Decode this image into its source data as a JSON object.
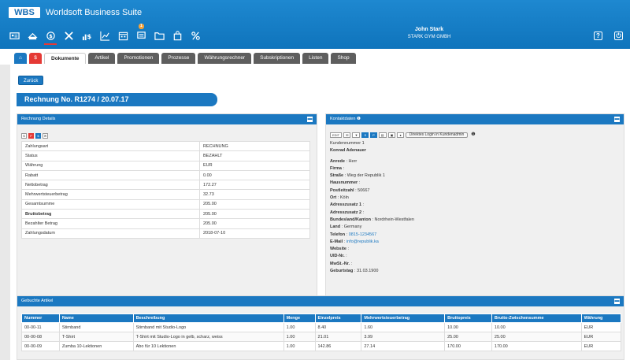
{
  "app": {
    "logo": "WBS",
    "title": "Worldsoft Business Suite"
  },
  "user": {
    "name": "John Stark",
    "company": "STARK GYM GMBH"
  },
  "header": {
    "help_label": "?",
    "power_label": "⏻",
    "notification_count": "1"
  },
  "tabs": [
    "Dokumente",
    "Artikel",
    "Promotionen",
    "Prozesse",
    "Währungsrechner",
    "Subskriptionen",
    "Listen",
    "Shop"
  ],
  "back_label": "Zurück",
  "heading": "Rechnung No. R1274 / 20.07.17",
  "details": {
    "title": "Rechnung Details",
    "rows": [
      {
        "label": "Zahlungsart",
        "value": "RECHNUNG"
      },
      {
        "label": "Status",
        "value": "BEZAHLT"
      },
      {
        "label": "Währung",
        "value": "EUR"
      },
      {
        "label": "Rabatt",
        "value": "0.00"
      },
      {
        "label": "Nettobetrag",
        "value": "172.27"
      },
      {
        "label": "Mehrwertsteuerbetrag",
        "value": "32.73"
      },
      {
        "label": "Gesamtsumme",
        "value": "205.00"
      },
      {
        "label": "Bruttobetrag",
        "value": "205.00"
      },
      {
        "label": "Bezahlter Betrag",
        "value": "205.00"
      },
      {
        "label": "Zahlungsdatum",
        "value": "2018-07-10"
      }
    ]
  },
  "contact": {
    "title": "Kontaktdaten",
    "edit_label": "EDIT",
    "direct_login_label": "Direktes Login in Kundenadmin",
    "customer_number": "Kundennummer 1",
    "customer_name": "Konrad Adenauer",
    "fields": [
      {
        "label": "Anrede",
        "value": "Herr"
      },
      {
        "label": "Firma",
        "value": ""
      },
      {
        "label": "Straße",
        "value": "Weg der Republik 1"
      },
      {
        "label": "Hausnummer",
        "value": ""
      },
      {
        "label": "Postleitzahl",
        "value": "50667"
      },
      {
        "label": "Ort",
        "value": "Köln"
      },
      {
        "label": "Adresszusatz 1",
        "value": ""
      },
      {
        "label": "Adresszusatz 2",
        "value": ""
      },
      {
        "label": "Bundesland/Kanton",
        "value": "Nordrhein-Westfalen"
      },
      {
        "label": "Land",
        "value": "Germany"
      },
      {
        "label": "Telefon",
        "value": "0815-1234567"
      },
      {
        "label": "E-Mail",
        "value": "info@republik.ka"
      },
      {
        "label": "Website",
        "value": ""
      },
      {
        "label": "UID-Nr.",
        "value": ""
      },
      {
        "label": "MwSt.-Nr.",
        "value": ""
      },
      {
        "label": "Geburtstag",
        "value": "31.03.1900"
      }
    ]
  },
  "items": {
    "title": "Gebuchte Artikel",
    "columns": [
      "Nummer",
      "Name",
      "Beschreibung",
      "Menge",
      "Einzelpreis",
      "Mehrwertsteuerbetrag",
      "Bruttopreis",
      "Brutto-Zwischensumme",
      "Währung"
    ],
    "rows": [
      [
        "00-00-11",
        "Stirnband",
        "Stirnband mit Studio-Logo",
        "1.00",
        "8.40",
        "1.60",
        "10.00",
        "10.00",
        "EUR"
      ],
      [
        "00-00-08",
        "T-Shirt",
        "T-Shirt mit Studio-Logo in gelb, scharz, weiss",
        "1.00",
        "21.01",
        "3.99",
        "25.00",
        "25.00",
        "EUR"
      ],
      [
        "00-00-09",
        "Zumba 10-Lektionen",
        "Abo für 10 Lektionen",
        "1.00",
        "142.86",
        "27.14",
        "170.00",
        "170.00",
        "EUR"
      ]
    ]
  }
}
